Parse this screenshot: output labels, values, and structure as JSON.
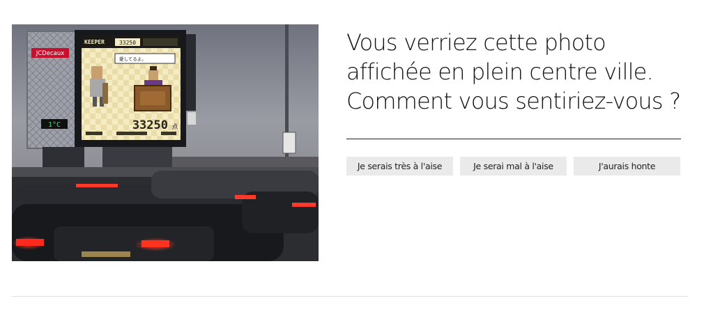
{
  "photo": {
    "board_brand": "JCDecaux",
    "temperature": "1°C",
    "game_title_line1": "KEEPER",
    "game_header_score": "33250",
    "speech_text": "愛してるよ。",
    "game_score": "33250",
    "score_suffix": "点"
  },
  "question": {
    "lines": [
      "Vous verriez cette photo",
      "affichée en plein centre ville.",
      "Comment vous sentiriez-vous ?"
    ]
  },
  "answers": [
    {
      "label": "Je serais très à l'aise"
    },
    {
      "label": "Je serai mal à l'aise"
    },
    {
      "label": "J'aurais honte"
    }
  ],
  "colors": {
    "button_bg": "#eaeaea",
    "text": "#111111",
    "brand_red": "#c8102e"
  }
}
